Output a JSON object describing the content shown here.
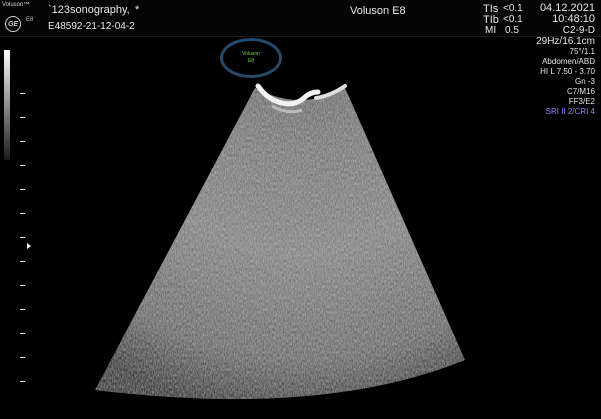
{
  "header": {
    "brand_text": "Voluson™",
    "brand_model": "E8",
    "ge_logo": "GE",
    "patient_name": "`123sonography,",
    "star": "*",
    "patient_id": "E48592-21-12-04-2",
    "device_title": "Voluson E8",
    "date": "04.12.2021",
    "time": "10:48:10"
  },
  "safety": {
    "tis_label": "TIs",
    "tis_value": "<0.1",
    "tib_label": "TIb",
    "tib_value": "<0.1",
    "mi_label": "MI",
    "mi_value": "0.5"
  },
  "params": {
    "probe": "C2-9-D",
    "frame": "29Hz/16.1cm",
    "angle": "75°/1.1",
    "preset": "Abdomen/ABD",
    "hi": "HI L  7.50 - 3.70",
    "gain": "Gn  -3",
    "cm": "C7/M16",
    "ff": "FF3/E2",
    "sri": "SRI II 2/CRI 4"
  },
  "watermark": {
    "line1": "Voluson",
    "line2": "E8",
    "ring_color": "#254a6a",
    "text_color": "#6ed14f"
  },
  "icons": {
    "ge": "ge-logo-icon",
    "focus": "focus-marker-icon"
  }
}
